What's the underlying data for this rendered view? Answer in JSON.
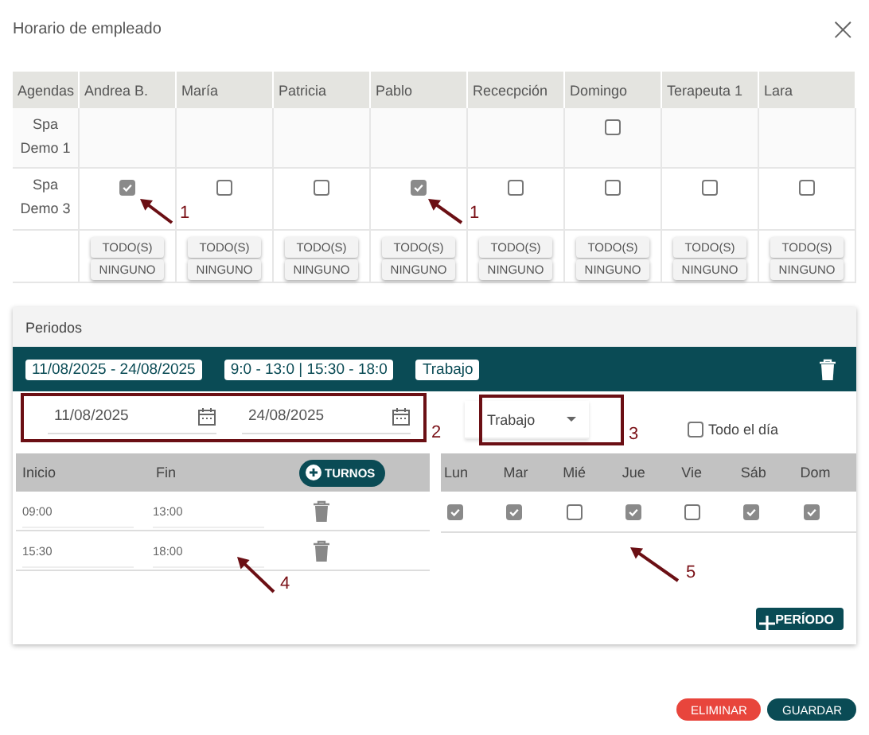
{
  "window": {
    "title": "Horario de empleado",
    "close": "×"
  },
  "agenda_table": {
    "corner": "Agendas",
    "columns": [
      "Andrea B.",
      "María",
      "Patricia",
      "Pablo",
      "Rececpción",
      "Domingo",
      "Terapeuta 1",
      "Lara"
    ],
    "rows": [
      {
        "agenda": "Spa Demo 1",
        "cells": [
          {
            "kind": "empty"
          },
          {
            "kind": "empty"
          },
          {
            "kind": "empty"
          },
          {
            "kind": "empty"
          },
          {
            "kind": "empty"
          },
          {
            "kind": "checkbox",
            "checked": false
          },
          {
            "kind": "empty"
          },
          {
            "kind": "empty"
          }
        ]
      },
      {
        "agenda": "Spa Demo 3",
        "cells": [
          {
            "kind": "checkbox",
            "checked": true
          },
          {
            "kind": "checkbox",
            "checked": false
          },
          {
            "kind": "checkbox",
            "checked": false
          },
          {
            "kind": "checkbox",
            "checked": true
          },
          {
            "kind": "checkbox",
            "checked": false
          },
          {
            "kind": "checkbox",
            "checked": false
          },
          {
            "kind": "checkbox",
            "checked": false
          },
          {
            "kind": "checkbox",
            "checked": false
          }
        ]
      }
    ],
    "column_buttons": [
      {
        "all": "TODO(S)",
        "none": "NINGUNO"
      },
      {
        "all": "TODO(S)",
        "none": "NINGUNO"
      },
      {
        "all": "TODO(S)",
        "none": "NINGUNO"
      },
      {
        "all": "TODO(S)",
        "none": "NINGUNO"
      },
      {
        "all": "TODO(S)",
        "none": "NINGUNO"
      },
      {
        "all": "TODO(S)",
        "none": "NINGUNO"
      },
      {
        "all": "TODO(S)",
        "none": "NINGUNO"
      },
      {
        "all": "TODO(S)",
        "none": "NINGUNO"
      }
    ]
  },
  "periods": {
    "title": "Periodos",
    "summary": {
      "dates": "11/08/2025 - 24/08/2025",
      "hours": "9:0 - 13:0 | 15:30 - 18:0",
      "type": "Trabajo"
    },
    "start_date": "11/08/2025",
    "end_date": "24/08/2025",
    "type_select": "Trabajo",
    "all_day": {
      "label": "Todo el día",
      "checked": false
    },
    "shift_columns": [
      "Inicio",
      "Fin"
    ],
    "shifts_button": "TURNOS",
    "shifts": [
      {
        "start": "09:00",
        "end": "13:00"
      },
      {
        "start": "15:30",
        "end": "18:00"
      }
    ],
    "days": [
      {
        "label": "Lun",
        "checked": true
      },
      {
        "label": "Mar",
        "checked": true
      },
      {
        "label": "Mié",
        "checked": false
      },
      {
        "label": "Jue",
        "checked": true
      },
      {
        "label": "Vie",
        "checked": false
      },
      {
        "label": "Sáb",
        "checked": true
      },
      {
        "label": "Dom",
        "checked": true
      }
    ],
    "add_period_button": "PERÍODO"
  },
  "buttons": [
    {
      "label": "ELIMINAR",
      "kind": "danger"
    },
    {
      "label": "GUARDAR",
      "kind": "primary"
    }
  ],
  "annotations": [
    {
      "kind": "arrow",
      "label": "1"
    },
    {
      "kind": "arrow",
      "label": "1"
    },
    {
      "kind": "box",
      "label": "2"
    },
    {
      "kind": "box",
      "label": "3"
    },
    {
      "kind": "arrow",
      "label": "4"
    },
    {
      "kind": "arrow",
      "label": "5"
    }
  ]
}
